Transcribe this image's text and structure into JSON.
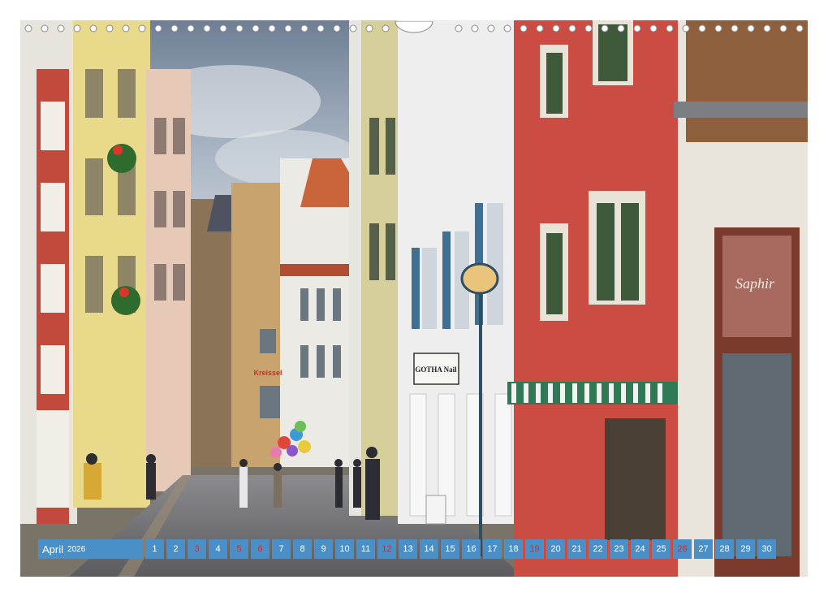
{
  "calendar": {
    "month": "April",
    "year": "2026",
    "days": [
      {
        "n": "1",
        "sun": false
      },
      {
        "n": "2",
        "sun": false
      },
      {
        "n": "3",
        "sun": true
      },
      {
        "n": "4",
        "sun": false
      },
      {
        "n": "5",
        "sun": true
      },
      {
        "n": "6",
        "sun": true
      },
      {
        "n": "7",
        "sun": false
      },
      {
        "n": "8",
        "sun": false
      },
      {
        "n": "9",
        "sun": false
      },
      {
        "n": "10",
        "sun": false
      },
      {
        "n": "11",
        "sun": false
      },
      {
        "n": "12",
        "sun": true
      },
      {
        "n": "13",
        "sun": false
      },
      {
        "n": "14",
        "sun": false
      },
      {
        "n": "15",
        "sun": false
      },
      {
        "n": "16",
        "sun": false
      },
      {
        "n": "17",
        "sun": false
      },
      {
        "n": "18",
        "sun": false
      },
      {
        "n": "19",
        "sun": true
      },
      {
        "n": "20",
        "sun": false
      },
      {
        "n": "21",
        "sun": false
      },
      {
        "n": "22",
        "sun": false
      },
      {
        "n": "23",
        "sun": false
      },
      {
        "n": "24",
        "sun": false
      },
      {
        "n": "25",
        "sun": false
      },
      {
        "n": "26",
        "sun": true
      },
      {
        "n": "27",
        "sun": false
      },
      {
        "n": "28",
        "sun": false
      },
      {
        "n": "29",
        "sun": false
      },
      {
        "n": "30",
        "sun": false
      }
    ]
  },
  "photo": {
    "sign_shop": "GOTHA Nail",
    "sign_store": "Saphir",
    "sign_red": "Kreissel"
  },
  "colors": {
    "calendar_bg": "#4a90c8",
    "sunday_text": "#d8292f"
  }
}
